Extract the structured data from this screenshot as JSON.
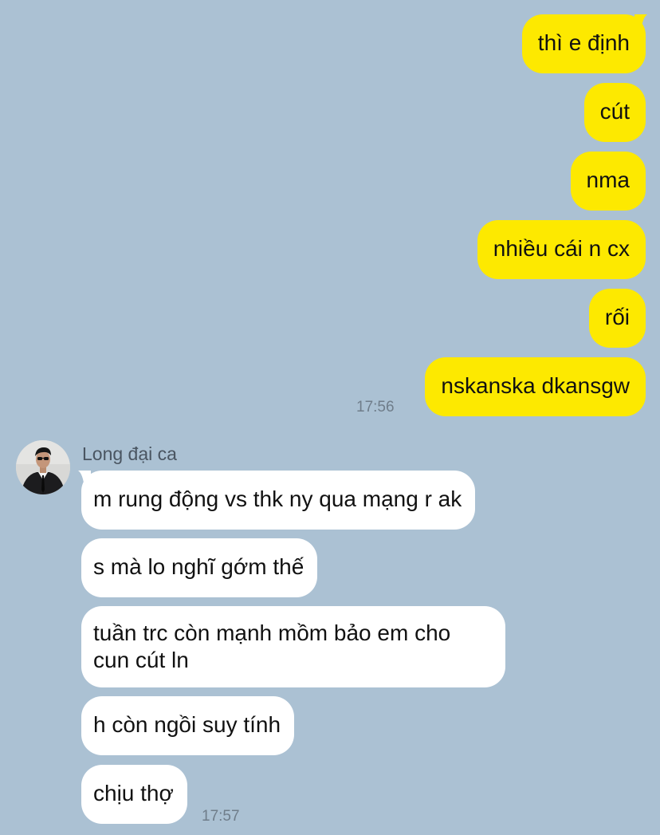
{
  "outgoing": {
    "messages": [
      "thì e định",
      "cút",
      "nma",
      "nhiều cái n cx",
      "rối",
      "nskanska dkansgw"
    ],
    "time": "17:56"
  },
  "incoming": {
    "sender": "Long đại ca",
    "avatar_icon": "person-avatar",
    "messages": [
      "m rung động vs thk ny qua mạng r ak",
      "s mà lo nghĩ gớm thế",
      "tuần trc còn mạnh mồm bảo em cho cun cút ln",
      "h còn ngồi suy tính",
      "chịu thợ"
    ],
    "time": "17:57"
  },
  "colors": {
    "background": "#abc1d3",
    "outgoing_bubble": "#fde900",
    "incoming_bubble": "#ffffff"
  }
}
